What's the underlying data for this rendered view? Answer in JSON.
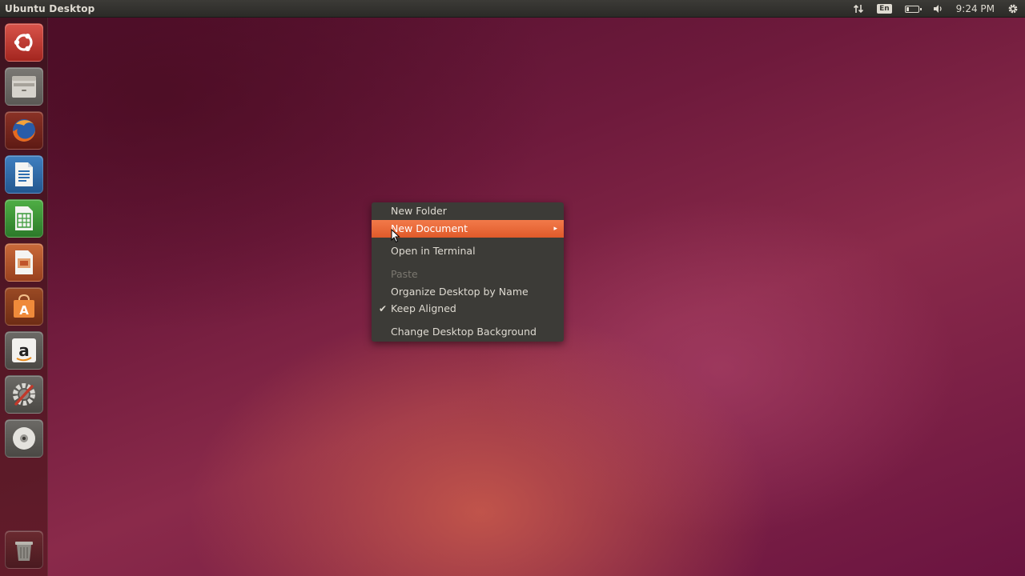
{
  "top_panel": {
    "title": "Ubuntu Desktop",
    "keyboard_layout": "En",
    "clock": "9:24 PM",
    "battery_level": 0.2
  },
  "launcher": {
    "items": [
      {
        "name": "Dash home",
        "icon": "ubuntu-logo-icon",
        "color": "#c0392b"
      },
      {
        "name": "Files",
        "icon": "file-manager-icon",
        "color": "#8c8a84"
      },
      {
        "name": "Firefox Web Browser",
        "icon": "firefox-icon",
        "color": "#c8502a"
      },
      {
        "name": "LibreOffice Writer",
        "icon": "libreoffice-writer-icon",
        "color": "#2f6fb0"
      },
      {
        "name": "LibreOffice Calc",
        "icon": "libreoffice-calc-icon",
        "color": "#3a9a3a"
      },
      {
        "name": "LibreOffice Impress",
        "icon": "libreoffice-impress-icon",
        "color": "#c0542a"
      },
      {
        "name": "Ubuntu Software Center",
        "icon": "software-center-icon",
        "color": "#e8772e"
      },
      {
        "name": "Amazon",
        "icon": "amazon-icon",
        "color": "#e7e5e0"
      },
      {
        "name": "System Settings",
        "icon": "system-settings-icon",
        "color": "#9a9893"
      },
      {
        "name": "Optical Drive",
        "icon": "dvd-icon",
        "color": "#d8d6d1"
      },
      {
        "name": "Trash",
        "icon": "trash-icon",
        "color": "#9a9893"
      }
    ]
  },
  "context_menu": {
    "items": [
      {
        "label": "New Folder",
        "state": "normal"
      },
      {
        "label": "New Document",
        "state": "highlighted",
        "has_submenu": true
      },
      {
        "label": "Open in Terminal",
        "state": "normal"
      },
      {
        "label": "Paste",
        "state": "disabled"
      },
      {
        "label": "Organize Desktop by Name",
        "state": "normal"
      },
      {
        "label": "Keep Aligned",
        "state": "checked"
      },
      {
        "label": "Change Desktop Background",
        "state": "normal"
      }
    ],
    "submenu_arrow": "▸",
    "check_glyph": "✔"
  },
  "colors": {
    "panel": "#3c3b37",
    "highlight": "#e95420",
    "menu_text": "#dfdbd2",
    "disabled_text": "#7a776f"
  }
}
